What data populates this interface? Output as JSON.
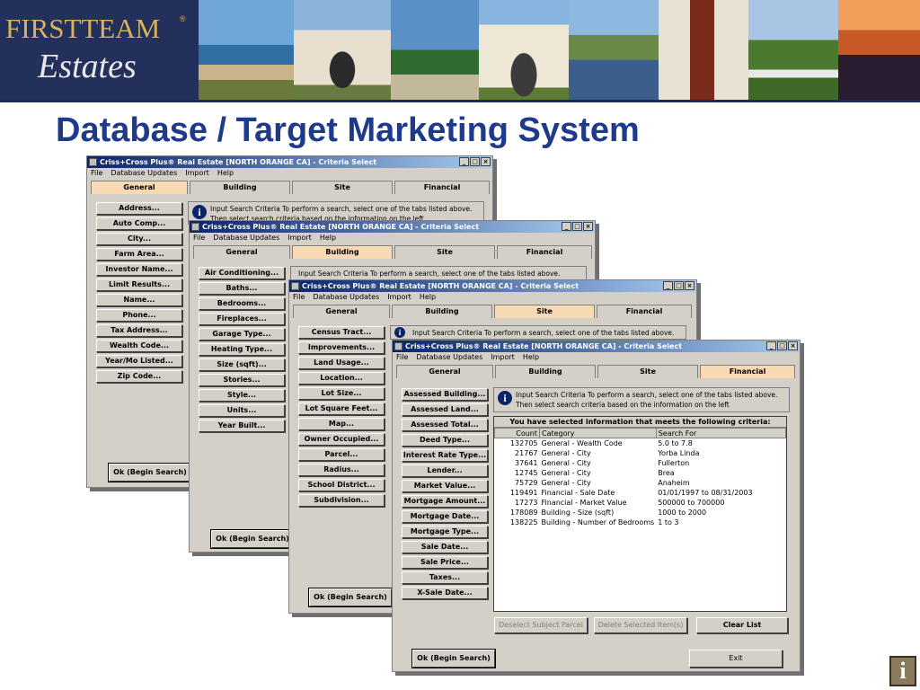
{
  "brand": {
    "line1": "FIRSTTEAM",
    "line2": "Estates",
    "mark": "®"
  },
  "slide_title": "Database / Target Marketing System",
  "window_title": "Criss+Cross Plus® Real Estate [NORTH ORANGE CA] - Criteria Select",
  "menu": [
    "File",
    "Database Updates",
    "Import",
    "Help"
  ],
  "tabs": [
    "General",
    "Building",
    "Site",
    "Financial"
  ],
  "info_line1": "Input Search Criteria     To perform a search, select one of the tabs listed above.",
  "info_line2": "Then select search criteria based on the information on the left",
  "general_buttons": [
    "Address...",
    "Auto Comp...",
    "City...",
    "Farm Area...",
    "Investor Name...",
    "Limit Results...",
    "Name...",
    "Phone...",
    "Tax Address...",
    "Wealth Code...",
    "Year/Mo Listed...",
    "Zip Code..."
  ],
  "building_buttons": [
    "Air Conditioning...",
    "Baths...",
    "Bedrooms...",
    "Fireplaces...",
    "Garage Type...",
    "Heating Type...",
    "Size (sqft)...",
    "Stories...",
    "Style...",
    "Units...",
    "Year Built..."
  ],
  "site_buttons": [
    "Census Tract...",
    "Improvements...",
    "Land Usage...",
    "Location...",
    "Lot Size...",
    "Lot Square Feet...",
    "Map...",
    "Owner Occupied...",
    "Parcel...",
    "Radius...",
    "School District...",
    "Subdivision..."
  ],
  "financial_buttons": [
    "Assessed Building...",
    "Assessed Land...",
    "Assessed Total...",
    "Deed Type...",
    "Interest Rate Type...",
    "Lender...",
    "Market Value...",
    "Mortgage Amount...",
    "Mortgage Date...",
    "Mortgage Type...",
    "Sale Date...",
    "Sale Price...",
    "Taxes...",
    "X-Sale Date..."
  ],
  "criteria": {
    "header": "You have selected information that meets the following criteria:",
    "columns": [
      "Count",
      "Category",
      "Search For"
    ],
    "rows": [
      [
        "132705",
        "General - Wealth Code",
        "5.0 to 7.8"
      ],
      [
        "21767",
        "General - City",
        "Yorba Linda"
      ],
      [
        "37641",
        "General - City",
        "Fullerton"
      ],
      [
        "12745",
        "General - City",
        "Brea"
      ],
      [
        "75729",
        "General - City",
        "Anaheim"
      ],
      [
        "119491",
        "Financial - Sale Date",
        "01/01/1997 to 08/31/2003"
      ],
      [
        "17273",
        "Financial - Market Value",
        "500000 to 700000"
      ],
      [
        "178089",
        "Building - Size (sqft)",
        "1000 to 2000"
      ],
      [
        "138225",
        "Building - Number of Bedrooms",
        "1 to 3"
      ]
    ]
  },
  "buttons": {
    "ok": "Ok (Begin Search)",
    "deselect": "Deselect Subject Parcel",
    "delete": "Delete Selected Item(s)",
    "clear": "Clear List",
    "exit": "Exit"
  },
  "win_controls": [
    "_",
    "□",
    "×"
  ],
  "info_glyph": "i",
  "help_glyph": "i"
}
